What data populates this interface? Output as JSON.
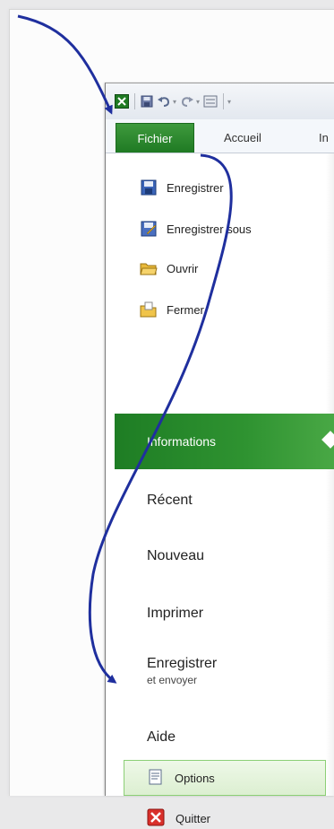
{
  "quick_access": {
    "icons": [
      "excel-logo-icon",
      "save-icon",
      "undo-icon",
      "redo-icon",
      "form-icon"
    ]
  },
  "ribbon": {
    "file_tab": "Fichier",
    "home_tab": "Accueil",
    "insert_tab_partial": "In"
  },
  "backstage": {
    "commands": [
      {
        "label": "Enregistrer",
        "icon": "save-icon"
      },
      {
        "label": "Enregistrer sous",
        "icon": "save-as-icon"
      },
      {
        "label": "Ouvrir",
        "icon": "open-folder-icon"
      },
      {
        "label": "Fermer",
        "icon": "close-folder-icon"
      }
    ],
    "selected": "Informations",
    "items": [
      {
        "label": "Récent"
      },
      {
        "label": "Nouveau"
      },
      {
        "label": "Imprimer"
      },
      {
        "label": "Enregistrer",
        "sub": "et envoyer"
      },
      {
        "label": "Aide"
      }
    ],
    "options": "Options",
    "quit": "Quitter"
  },
  "colors": {
    "accent_green": "#2f9331",
    "arrow_blue": "#1f2f9e",
    "highlight_border": "#8ccf76"
  }
}
